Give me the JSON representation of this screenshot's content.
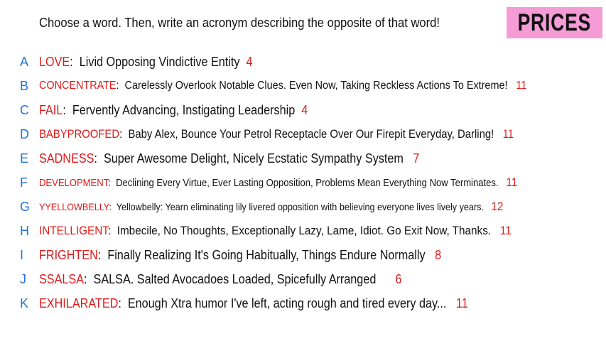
{
  "header": {
    "prompt": "Choose a word. Then, write an acronym describing the opposite of that word!",
    "prices_label": "PRICES"
  },
  "colors": {
    "letter": "#2175d9",
    "word": "#e01919",
    "number": "#e01919",
    "prices_bg": "#f59bd6"
  },
  "entries": [
    {
      "letter": "A",
      "word": "LOVE",
      "acronym": "Livid Opposing Vindictive Entity",
      "price": "4"
    },
    {
      "letter": "B",
      "word": "CONCENTRATE",
      "acronym": "Carelessly Overlook Notable Clues. Even Now, Taking Reckless Actions To Extreme!",
      "price": "11"
    },
    {
      "letter": "C",
      "word": "FAIL",
      "acronym": "Fervently Advancing, Instigating Leadership",
      "price": "4"
    },
    {
      "letter": "D",
      "word": "BABYPROOFED",
      "acronym": "Baby Alex, Bounce Your Petrol Receptacle Over Our Firepit Everyday, Darling!",
      "price": "11"
    },
    {
      "letter": "E",
      "word": "SADNESS",
      "acronym": "Super Awesome Delight, Nicely Ecstatic Sympathy System",
      "price": "7"
    },
    {
      "letter": "F",
      "word": "DEVELOPMENT",
      "acronym": "Declining Every Virtue, Ever Lasting Opposition, Problems Mean Everything Now Terminates.",
      "price": "11"
    },
    {
      "letter": "G",
      "word": "YYELLOWBELLY",
      "acronym": "Yellowbelly: Yearn eliminating lily livered opposition with believing everyone lives lively years.",
      "price": "12"
    },
    {
      "letter": "H",
      "word": "INTELLIGENT",
      "acronym": "Imbecile, No Thoughts, Exceptionally Lazy, Lame, Idiot. Go Exit Now, Thanks.",
      "price": "11"
    },
    {
      "letter": "I",
      "word": "FRIGHTEN",
      "acronym": "Finally Realizing It's Going Habitually, Things Endure Normally",
      "price": "8"
    },
    {
      "letter": "J",
      "word": "SSALSA",
      "acronym": "SALSA. Salted Avocadoes Loaded, Spicefully Arranged",
      "price": "6"
    },
    {
      "letter": "K",
      "word": "EXHILARATED",
      "acronym": "Enough Xtra humor I've left, acting rough and tired every day...",
      "price": "11"
    }
  ]
}
